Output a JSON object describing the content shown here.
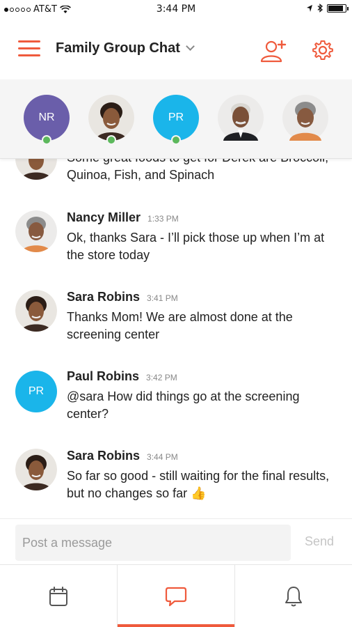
{
  "status_bar": {
    "carrier": "AT&T",
    "time": "3:44 PM",
    "signal_bars_filled": 1,
    "signal_bars_total": 5,
    "battery_level": 0.9
  },
  "header": {
    "title": "Family Group Chat",
    "menu_icon": "hamburger-menu-icon",
    "add_member_icon": "add-person-icon",
    "settings_icon": "gear-icon",
    "accent_color": "#ef5a3c"
  },
  "members": [
    {
      "initials": "NR",
      "color": "#6a5eaa",
      "online": true
    },
    {
      "initials": "",
      "photo": "woman-young",
      "online": true
    },
    {
      "initials": "PR",
      "color": "#1ab5ea",
      "online": true
    },
    {
      "initials": "",
      "photo": "man-older",
      "online": false
    },
    {
      "initials": "",
      "photo": "woman-older",
      "online": false
    }
  ],
  "messages": [
    {
      "name": "",
      "time": "",
      "text": "Some great foods to get for Derek are Broccoli, Quinoa, Fish, and Spinach",
      "avatar": "woman-young"
    },
    {
      "name": "Nancy Miller",
      "time": "1:33 PM",
      "text": "Ok, thanks Sara - I’ll pick those up when I’m at the store today",
      "avatar": "woman-older"
    },
    {
      "name": "Sara Robins",
      "time": "3:41 PM",
      "text": "Thanks Mom! We are almost done at the screening center",
      "avatar": "woman-young"
    },
    {
      "name": "Paul Robins",
      "time": "3:42 PM",
      "text": "@sara How did things go at the screening center?",
      "avatar_initials": "PR",
      "avatar_color": "#1ab5ea"
    },
    {
      "name": "Sara Robins",
      "time": "3:44 PM",
      "text": "So far so good - still waiting for the final results, but no changes so far 👍",
      "avatar": "woman-young"
    }
  ],
  "composer": {
    "placeholder": "Post a message",
    "send_label": "Send"
  },
  "tabs": [
    {
      "icon": "calendar-icon",
      "active": false
    },
    {
      "icon": "chat-bubble-icon",
      "active": true
    },
    {
      "icon": "bell-icon",
      "active": false
    }
  ]
}
